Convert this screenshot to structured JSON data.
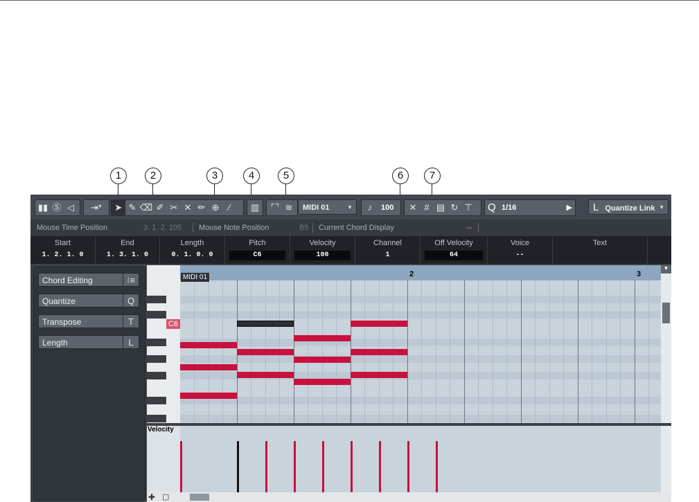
{
  "callouts": [
    "1",
    "2",
    "3",
    "4",
    "5",
    "6",
    "7"
  ],
  "toolbar": {
    "part_name": "MIDI 01",
    "velocity": "100",
    "quantize_value": "1/16",
    "length_quantize": "Quantize Link",
    "q_symbol": "Q",
    "l_symbol": "L"
  },
  "infobar": {
    "mouse_time_label": "Mouse Time Position",
    "mouse_time_value": "3. 1. 2. 105",
    "mouse_note_label": "Mouse Note Position",
    "mouse_note_value": "B5",
    "chord_label": "Current Chord Display",
    "chord_value": "--"
  },
  "infoline": [
    {
      "header": "Start",
      "value": "1. 2. 1.   0"
    },
    {
      "header": "End",
      "value": "1. 3. 1.   0"
    },
    {
      "header": "Length",
      "value": "0. 1. 0.   0"
    },
    {
      "header": "Pitch",
      "value": "C6"
    },
    {
      "header": "Velocity",
      "value": "100"
    },
    {
      "header": "Channel",
      "value": "1"
    },
    {
      "header": "Off Velocity",
      "value": "64"
    },
    {
      "header": "Voice",
      "value": "--"
    },
    {
      "header": "Text",
      "value": ""
    }
  ],
  "inspector": [
    {
      "label": "Chord Editing",
      "key": "⁝≡"
    },
    {
      "label": "Quantize",
      "key": "Q"
    },
    {
      "label": "Transpose",
      "key": "T"
    },
    {
      "label": "Length",
      "key": "L"
    }
  ],
  "keyboard": {
    "highlight": "C6"
  },
  "ruler": {
    "part": "MIDI 01",
    "bar2": "2",
    "bar3": "3"
  },
  "velocity_lane": {
    "label": "Velocity",
    "levels": [
      0.92,
      0.92,
      0.92,
      0.92,
      0.92,
      0.92,
      0.92,
      0.92,
      0.92
    ]
  },
  "colors": {
    "note": "#c8113f",
    "selected_note": "#2c2f33",
    "ruler": "#8ea6bf"
  }
}
